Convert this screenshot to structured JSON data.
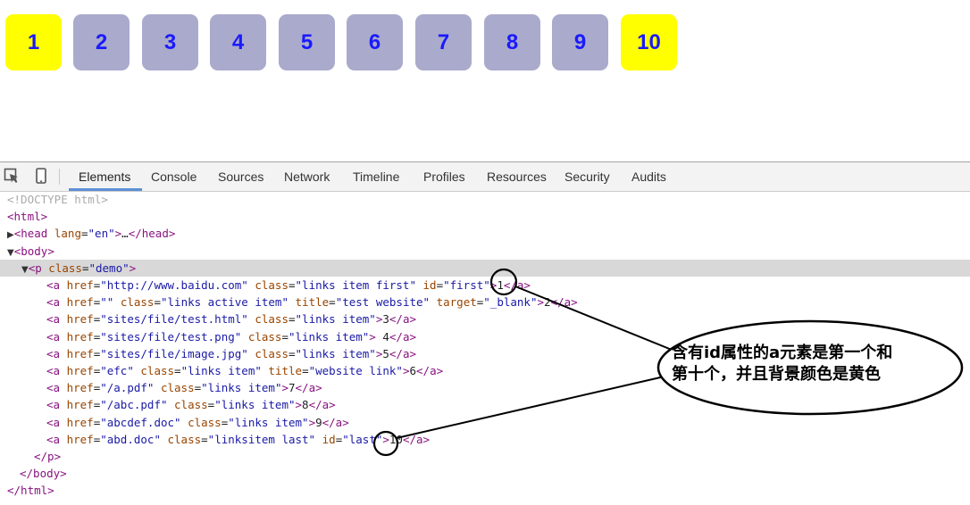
{
  "pagination": {
    "tiles": [
      {
        "label": "1",
        "highlight": true
      },
      {
        "label": "2",
        "highlight": false
      },
      {
        "label": "3",
        "highlight": false
      },
      {
        "label": "4",
        "highlight": false
      },
      {
        "label": "5",
        "highlight": false
      },
      {
        "label": "6",
        "highlight": false
      },
      {
        "label": "7",
        "highlight": false
      },
      {
        "label": "8",
        "highlight": false
      },
      {
        "label": "9",
        "highlight": false
      },
      {
        "label": "10",
        "highlight": true
      }
    ],
    "colors": {
      "tile": "#aaaacc",
      "highlight": "#ffff00",
      "text": "#1a1aff"
    }
  },
  "devtools": {
    "icons": [
      "inspect-element-icon",
      "device-mode-icon"
    ],
    "tabs": [
      "Elements",
      "Console",
      "Sources",
      "Network",
      "Timeline",
      "Profiles",
      "Resources",
      "Security",
      "Audits"
    ],
    "active_tab": "Elements"
  },
  "dom": {
    "doctype": "<!DOCTYPE html>",
    "html_open": "<html>",
    "head": {
      "tag": "head",
      "attr": "lang",
      "value": "en",
      "ellipsis": "…"
    },
    "body_open": "<body>",
    "p": {
      "attr": "class",
      "value": "demo"
    },
    "links": [
      {
        "pre": [
          [
            "href",
            "http://www.baidu.com"
          ],
          [
            "class",
            "links item first"
          ]
        ],
        "mid": "id",
        "post": [
          [
            "",
            "first"
          ]
        ],
        "text": "1"
      },
      {
        "pre": [
          [
            "href",
            ""
          ],
          [
            "class",
            "links active item"
          ],
          [
            "title",
            "test website"
          ],
          [
            "target",
            "_blank"
          ]
        ],
        "text": "2"
      },
      {
        "pre": [
          [
            "href",
            "sites/file/test.html"
          ],
          [
            "class",
            "links item"
          ]
        ],
        "text": "3"
      },
      {
        "pre": [
          [
            "href",
            "sites/file/test.png"
          ],
          [
            "class",
            "links item"
          ]
        ],
        "text": " 4"
      },
      {
        "pre": [
          [
            "href",
            "sites/file/image.jpg"
          ],
          [
            "class",
            "links item"
          ]
        ],
        "text": "5"
      },
      {
        "pre": [
          [
            "href",
            "efc"
          ],
          [
            "class",
            "links item"
          ],
          [
            "title",
            "website link"
          ]
        ],
        "text": "6"
      },
      {
        "pre": [
          [
            "href",
            "/a.pdf"
          ],
          [
            "class",
            "links item"
          ]
        ],
        "text": "7"
      },
      {
        "pre": [
          [
            "href",
            "/abc.pdf"
          ],
          [
            "class",
            "links item"
          ]
        ],
        "text": "8"
      },
      {
        "pre": [
          [
            "href",
            "abcdef.doc"
          ],
          [
            "class",
            "links item"
          ]
        ],
        "text": "9"
      },
      {
        "pre": [
          [
            "href",
            "abd.doc"
          ],
          [
            "class",
            "linksitem last"
          ]
        ],
        "mid": "id",
        "post": [
          [
            "",
            "last"
          ]
        ],
        "text": "10"
      }
    ],
    "p_close": "</p>",
    "body_close": "</body>",
    "html_close": "</html>"
  },
  "annotation": {
    "text_line1": "含有id属性的a元素是第一个和",
    "text_line2": "第十个，并且背景颜色是黄色"
  }
}
